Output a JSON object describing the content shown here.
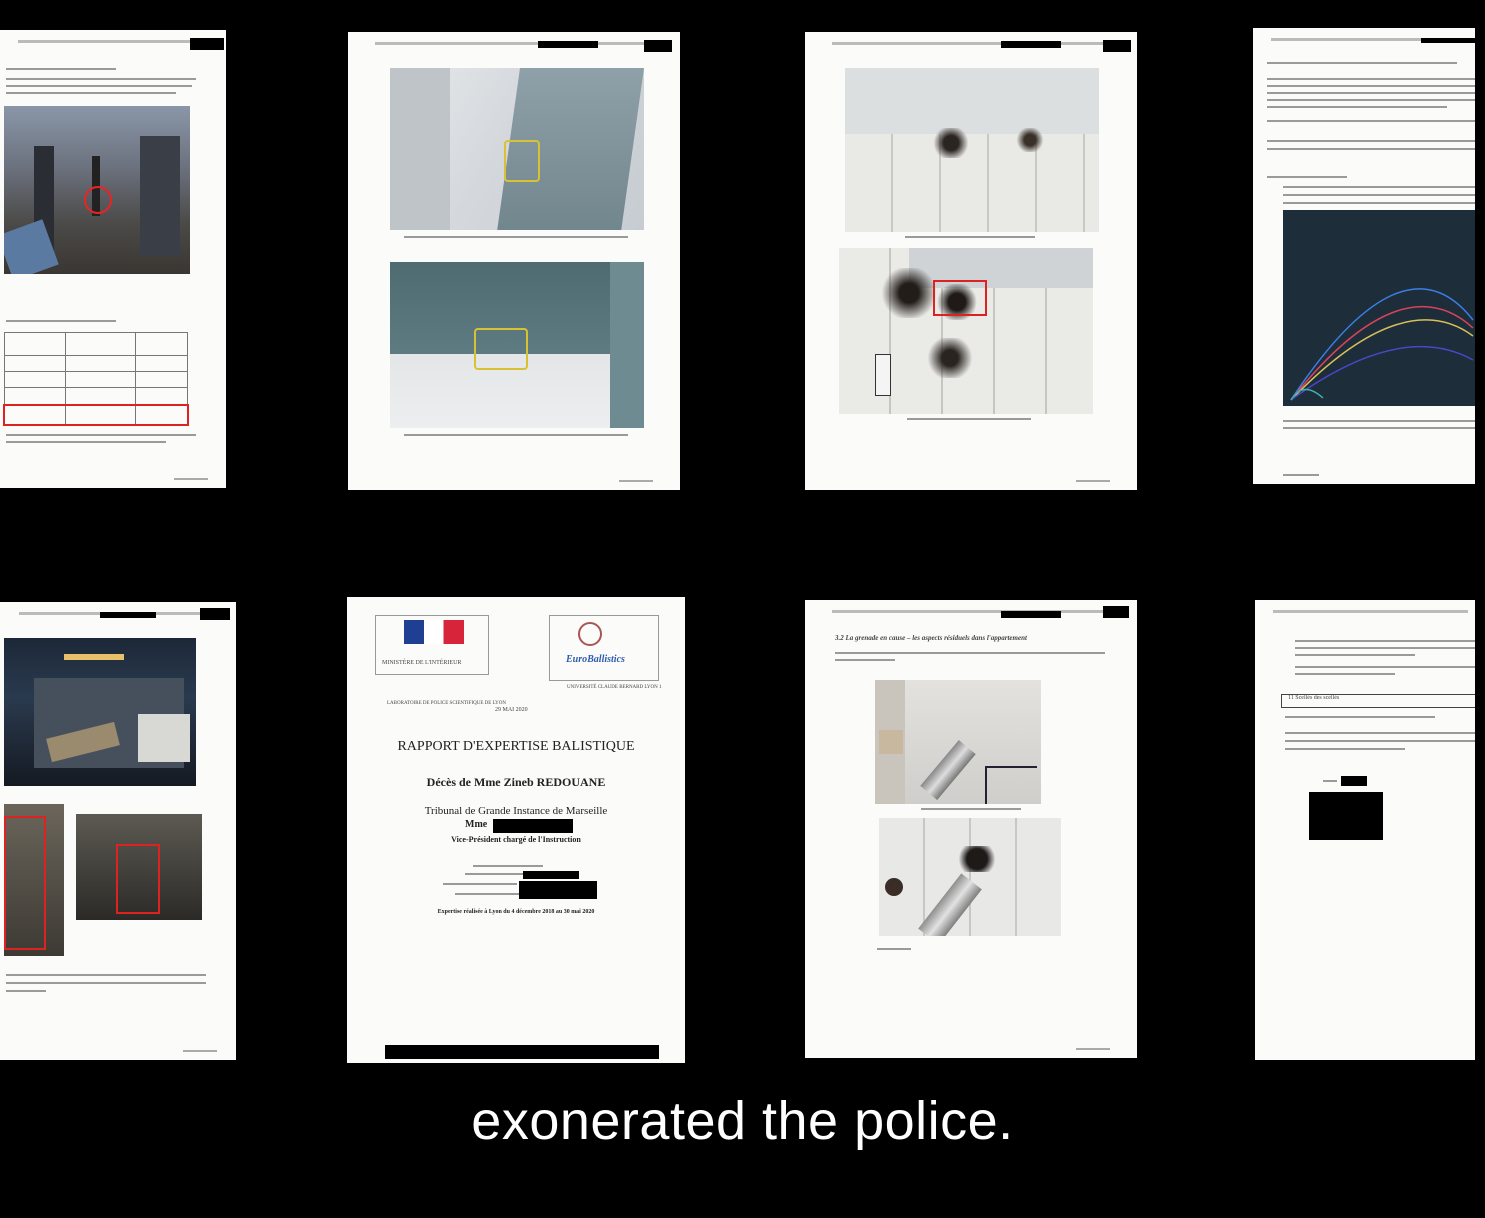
{
  "subtitle": "exonerated the police.",
  "cover": {
    "ministry": "MINISTÈRE DE L'INTÉRIEUR",
    "brand": "EuroBallistics",
    "lab": "LABORATOIRE DE POLICE SCIENTIFIQUE DE LYON",
    "university": "UNIVERSITÉ CLAUDE BERNARD LYON 1",
    "date": "29 MAI 2020",
    "title": "RAPPORT D'EXPERTISE BALISTIQUE",
    "subject": "Décès de Mme Zineb REDOUANE",
    "court": "Tribunal de Grande Instance de Marseille",
    "judge_prefix": "Mme",
    "judge_role": "Vice-Président chargé de l'Instruction",
    "footer_line": "Expertise réalisée à Lyon du 4 décembre 2018 au 30 mai 2020"
  },
  "page7": {
    "heading": "3.2 La grenade en cause – les aspects résiduels dans l'appartement"
  },
  "page8": {
    "heading": "11 Scellés des scellés"
  },
  "chart_colors": [
    "#3c7ee8",
    "#d9435b",
    "#d8c05a",
    "#4a46c8",
    "#3fb2a8"
  ]
}
